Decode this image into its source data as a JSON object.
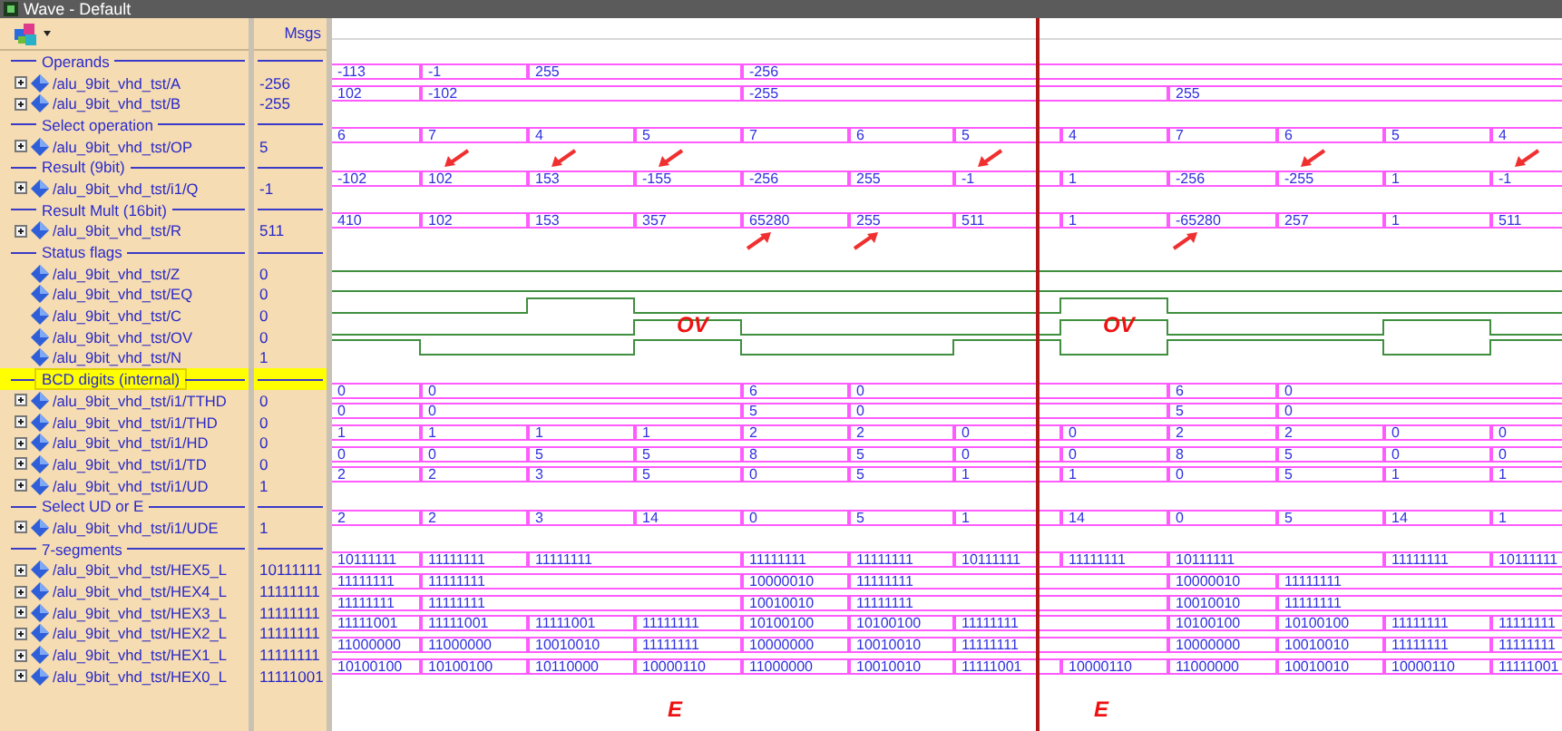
{
  "window": {
    "title": "Wave - Default"
  },
  "header": {
    "value_column": "Msgs"
  },
  "cursor_shown": true,
  "rows": [
    {
      "kind": "group",
      "label": "Operands",
      "highlighted": false
    },
    {
      "kind": "bus",
      "name": "/alu_9bit_vhd_tst/A",
      "value": "-256",
      "wave": [
        {
          "kind": "change",
          "value": "-113"
        },
        {
          "kind": "change",
          "value": "-1"
        },
        {
          "kind": "change",
          "value": "255"
        },
        {
          "kind": "hold"
        },
        {
          "kind": "change",
          "value": "-256"
        },
        {
          "kind": "hold"
        },
        {
          "kind": "hold"
        },
        {
          "kind": "hold"
        },
        {
          "kind": "hold"
        },
        {
          "kind": "hold"
        },
        {
          "kind": "hold"
        },
        {
          "kind": "hold"
        }
      ]
    },
    {
      "kind": "bus",
      "name": "/alu_9bit_vhd_tst/B",
      "value": "-255",
      "wave": [
        {
          "kind": "change",
          "value": "102"
        },
        {
          "kind": "change",
          "value": "-102"
        },
        {
          "kind": "hold"
        },
        {
          "kind": "hold"
        },
        {
          "kind": "change",
          "value": "-255"
        },
        {
          "kind": "hold"
        },
        {
          "kind": "hold"
        },
        {
          "kind": "hold"
        },
        {
          "kind": "change",
          "value": "255"
        },
        {
          "kind": "hold"
        },
        {
          "kind": "hold"
        },
        {
          "kind": "hold"
        }
      ]
    },
    {
      "kind": "group",
      "label": "Select operation",
      "highlighted": false
    },
    {
      "kind": "bus",
      "name": "/alu_9bit_vhd_tst/OP",
      "value": "5",
      "wave": [
        {
          "kind": "change",
          "value": "6"
        },
        {
          "kind": "change",
          "value": "7"
        },
        {
          "kind": "change",
          "value": "4"
        },
        {
          "kind": "change",
          "value": "5"
        },
        {
          "kind": "change",
          "value": "7"
        },
        {
          "kind": "change",
          "value": "6"
        },
        {
          "kind": "change",
          "value": "5"
        },
        {
          "kind": "change",
          "value": "4"
        },
        {
          "kind": "change",
          "value": "7"
        },
        {
          "kind": "change",
          "value": "6"
        },
        {
          "kind": "change",
          "value": "5"
        },
        {
          "kind": "change",
          "value": "4"
        }
      ]
    },
    {
      "kind": "group",
      "label": "Result (9bit)",
      "highlighted": false
    },
    {
      "kind": "bus",
      "name": "/alu_9bit_vhd_tst/i1/Q",
      "value": "-1",
      "wave": [
        {
          "kind": "change",
          "value": "-102",
          "arrow_above": false
        },
        {
          "kind": "change",
          "value": "102",
          "arrow_above": true
        },
        {
          "kind": "change",
          "value": "153",
          "arrow_above": true
        },
        {
          "kind": "change",
          "value": "-155",
          "arrow_above": true
        },
        {
          "kind": "change",
          "value": "-256",
          "arrow_above": false
        },
        {
          "kind": "change",
          "value": "255",
          "arrow_above": false
        },
        {
          "kind": "change",
          "value": "-1",
          "arrow_above": true
        },
        {
          "kind": "change",
          "value": "1",
          "arrow_above": false
        },
        {
          "kind": "change",
          "value": "-256",
          "arrow_above": false
        },
        {
          "kind": "change",
          "value": "-255",
          "arrow_above": true
        },
        {
          "kind": "change",
          "value": "1",
          "arrow_above": false
        },
        {
          "kind": "change",
          "value": "-1",
          "arrow_above": true
        }
      ]
    },
    {
      "kind": "group",
      "label": "Result Mult (16bit)",
      "highlighted": false
    },
    {
      "kind": "bus",
      "name": "/alu_9bit_vhd_tst/R",
      "value": "511",
      "wave": [
        {
          "kind": "change",
          "value": "410",
          "arrow_below": false
        },
        {
          "kind": "change",
          "value": "102",
          "arrow_below": false
        },
        {
          "kind": "change",
          "value": "153",
          "arrow_below": false
        },
        {
          "kind": "change",
          "value": "357",
          "arrow_below": false
        },
        {
          "kind": "change",
          "value": "65280",
          "arrow_below": true
        },
        {
          "kind": "change",
          "value": "255",
          "arrow_below": true
        },
        {
          "kind": "change",
          "value": "511",
          "arrow_below": false
        },
        {
          "kind": "change",
          "value": "1",
          "arrow_below": false
        },
        {
          "kind": "change",
          "value": "-65280",
          "arrow_below": true
        },
        {
          "kind": "change",
          "value": "257",
          "arrow_below": false
        },
        {
          "kind": "change",
          "value": "1",
          "arrow_below": false
        },
        {
          "kind": "change",
          "value": "511",
          "arrow_below": false
        }
      ]
    },
    {
      "kind": "group",
      "label": "Status flags",
      "highlighted": false
    },
    {
      "kind": "bit",
      "name": "/alu_9bit_vhd_tst/Z",
      "value": "0",
      "wave": [
        {
          "high": false
        },
        {
          "high": false
        },
        {
          "high": false
        },
        {
          "high": false
        },
        {
          "high": false
        },
        {
          "high": false
        },
        {
          "high": false
        },
        {
          "high": false
        },
        {
          "high": false
        },
        {
          "high": false
        },
        {
          "high": false
        },
        {
          "high": false
        }
      ]
    },
    {
      "kind": "bit",
      "name": "/alu_9bit_vhd_tst/EQ",
      "value": "0",
      "wave": [
        {
          "high": false
        },
        {
          "high": false
        },
        {
          "high": false
        },
        {
          "high": false
        },
        {
          "high": false
        },
        {
          "high": false
        },
        {
          "high": false
        },
        {
          "high": false
        },
        {
          "high": false
        },
        {
          "high": false
        },
        {
          "high": false
        },
        {
          "high": false
        }
      ]
    },
    {
      "kind": "bit",
      "name": "/alu_9bit_vhd_tst/C",
      "value": "0",
      "wave": [
        {
          "high": false
        },
        {
          "high": false
        },
        {
          "high": true
        },
        {
          "high": false
        },
        {
          "high": false
        },
        {
          "high": false
        },
        {
          "high": false
        },
        {
          "high": true
        },
        {
          "high": false
        },
        {
          "high": false
        },
        {
          "high": false
        },
        {
          "high": false
        }
      ]
    },
    {
      "kind": "bit",
      "name": "/alu_9bit_vhd_tst/OV",
      "value": "0",
      "wave": [
        {
          "high": false
        },
        {
          "high": false
        },
        {
          "high": false
        },
        {
          "high": true,
          "note": "OV"
        },
        {
          "high": false
        },
        {
          "high": false
        },
        {
          "high": false
        },
        {
          "high": true,
          "note": "OV"
        },
        {
          "high": false
        },
        {
          "high": false
        },
        {
          "high": true
        },
        {
          "high": false
        }
      ]
    },
    {
      "kind": "bit",
      "name": "/alu_9bit_vhd_tst/N",
      "value": "1",
      "wave": [
        {
          "high": true
        },
        {
          "high": false
        },
        {
          "high": false
        },
        {
          "high": true
        },
        {
          "high": false
        },
        {
          "high": false
        },
        {
          "high": true
        },
        {
          "high": false
        },
        {
          "high": true
        },
        {
          "high": true
        },
        {
          "high": false
        },
        {
          "high": true
        }
      ]
    },
    {
      "kind": "group",
      "label": "BCD digits (internal)",
      "highlighted": true
    },
    {
      "kind": "bus",
      "name": "/alu_9bit_vhd_tst/i1/TTHD",
      "value": "0",
      "wave": [
        {
          "kind": "change",
          "value": "0"
        },
        {
          "kind": "change",
          "value": "0"
        },
        {
          "kind": "hold"
        },
        {
          "kind": "hold"
        },
        {
          "kind": "change",
          "value": "6"
        },
        {
          "kind": "change",
          "value": "0"
        },
        {
          "kind": "hold"
        },
        {
          "kind": "hold"
        },
        {
          "kind": "change",
          "value": "6"
        },
        {
          "kind": "change",
          "value": "0"
        },
        {
          "kind": "hold"
        },
        {
          "kind": "hold"
        }
      ]
    },
    {
      "kind": "bus",
      "name": "/alu_9bit_vhd_tst/i1/THD",
      "value": "0",
      "wave": [
        {
          "kind": "change",
          "value": "0"
        },
        {
          "kind": "change",
          "value": "0"
        },
        {
          "kind": "hold"
        },
        {
          "kind": "hold"
        },
        {
          "kind": "change",
          "value": "5"
        },
        {
          "kind": "change",
          "value": "0"
        },
        {
          "kind": "hold"
        },
        {
          "kind": "hold"
        },
        {
          "kind": "change",
          "value": "5"
        },
        {
          "kind": "change",
          "value": "0"
        },
        {
          "kind": "hold"
        },
        {
          "kind": "hold"
        }
      ]
    },
    {
      "kind": "bus",
      "name": "/alu_9bit_vhd_tst/i1/HD",
      "value": "0",
      "wave": [
        {
          "kind": "change",
          "value": "1"
        },
        {
          "kind": "change",
          "value": "1"
        },
        {
          "kind": "change",
          "value": "1"
        },
        {
          "kind": "change",
          "value": "1"
        },
        {
          "kind": "change",
          "value": "2"
        },
        {
          "kind": "change",
          "value": "2"
        },
        {
          "kind": "change",
          "value": "0"
        },
        {
          "kind": "change",
          "value": "0"
        },
        {
          "kind": "change",
          "value": "2"
        },
        {
          "kind": "change",
          "value": "2"
        },
        {
          "kind": "change",
          "value": "0"
        },
        {
          "kind": "change",
          "value": "0"
        }
      ]
    },
    {
      "kind": "bus",
      "name": "/alu_9bit_vhd_tst/i1/TD",
      "value": "0",
      "wave": [
        {
          "kind": "change",
          "value": "0"
        },
        {
          "kind": "change",
          "value": "0"
        },
        {
          "kind": "change",
          "value": "5"
        },
        {
          "kind": "change",
          "value": "5"
        },
        {
          "kind": "change",
          "value": "8"
        },
        {
          "kind": "change",
          "value": "5"
        },
        {
          "kind": "change",
          "value": "0"
        },
        {
          "kind": "change",
          "value": "0"
        },
        {
          "kind": "change",
          "value": "8"
        },
        {
          "kind": "change",
          "value": "5"
        },
        {
          "kind": "change",
          "value": "0"
        },
        {
          "kind": "change",
          "value": "0"
        }
      ]
    },
    {
      "kind": "bus",
      "name": "/alu_9bit_vhd_tst/i1/UD",
      "value": "1",
      "wave": [
        {
          "kind": "change",
          "value": "2"
        },
        {
          "kind": "change",
          "value": "2"
        },
        {
          "kind": "change",
          "value": "3"
        },
        {
          "kind": "change",
          "value": "5"
        },
        {
          "kind": "change",
          "value": "0"
        },
        {
          "kind": "change",
          "value": "5"
        },
        {
          "kind": "change",
          "value": "1"
        },
        {
          "kind": "change",
          "value": "1"
        },
        {
          "kind": "change",
          "value": "0"
        },
        {
          "kind": "change",
          "value": "5"
        },
        {
          "kind": "change",
          "value": "1"
        },
        {
          "kind": "change",
          "value": "1"
        }
      ]
    },
    {
      "kind": "group",
      "label": "Select UD or E",
      "highlighted": false
    },
    {
      "kind": "bus",
      "name": "/alu_9bit_vhd_tst/i1/UDE",
      "value": "1",
      "wave": [
        {
          "kind": "change",
          "value": "2"
        },
        {
          "kind": "change",
          "value": "2"
        },
        {
          "kind": "change",
          "value": "3"
        },
        {
          "kind": "change",
          "value": "14"
        },
        {
          "kind": "change",
          "value": "0"
        },
        {
          "kind": "change",
          "value": "5"
        },
        {
          "kind": "change",
          "value": "1"
        },
        {
          "kind": "change",
          "value": "14"
        },
        {
          "kind": "change",
          "value": "0"
        },
        {
          "kind": "change",
          "value": "5"
        },
        {
          "kind": "change",
          "value": "14"
        },
        {
          "kind": "change",
          "value": "1"
        }
      ]
    },
    {
      "kind": "group",
      "label": "7-segments",
      "highlighted": false
    },
    {
      "kind": "bus",
      "name": "/alu_9bit_vhd_tst/HEX5_L",
      "value": "10111111",
      "wave": [
        {
          "kind": "change",
          "value": "10111111"
        },
        {
          "kind": "change",
          "value": "11111111"
        },
        {
          "kind": "change",
          "value": "11111111"
        },
        {
          "kind": "hold"
        },
        {
          "kind": "change",
          "value": "11111111"
        },
        {
          "kind": "change",
          "value": "11111111"
        },
        {
          "kind": "change",
          "value": "10111111"
        },
        {
          "kind": "change",
          "value": "11111111"
        },
        {
          "kind": "change",
          "value": "10111111"
        },
        {
          "kind": "hold"
        },
        {
          "kind": "change",
          "value": "11111111"
        },
        {
          "kind": "change",
          "value": "10111111"
        }
      ]
    },
    {
      "kind": "bus",
      "name": "/alu_9bit_vhd_tst/HEX4_L",
      "value": "11111111",
      "wave": [
        {
          "kind": "change",
          "value": "11111111"
        },
        {
          "kind": "change",
          "value": "11111111"
        },
        {
          "kind": "hold"
        },
        {
          "kind": "hold"
        },
        {
          "kind": "change",
          "value": "10000010"
        },
        {
          "kind": "change",
          "value": "11111111"
        },
        {
          "kind": "hold"
        },
        {
          "kind": "hold"
        },
        {
          "kind": "change",
          "value": "10000010"
        },
        {
          "kind": "change",
          "value": "11111111"
        },
        {
          "kind": "hold"
        },
        {
          "kind": "hold"
        }
      ]
    },
    {
      "kind": "bus",
      "name": "/alu_9bit_vhd_tst/HEX3_L",
      "value": "11111111",
      "wave": [
        {
          "kind": "change",
          "value": "11111111"
        },
        {
          "kind": "change",
          "value": "11111111"
        },
        {
          "kind": "hold"
        },
        {
          "kind": "hold"
        },
        {
          "kind": "change",
          "value": "10010010"
        },
        {
          "kind": "change",
          "value": "11111111"
        },
        {
          "kind": "hold"
        },
        {
          "kind": "hold"
        },
        {
          "kind": "change",
          "value": "10010010"
        },
        {
          "kind": "change",
          "value": "11111111"
        },
        {
          "kind": "hold"
        },
        {
          "kind": "hold"
        }
      ]
    },
    {
      "kind": "bus",
      "name": "/alu_9bit_vhd_tst/HEX2_L",
      "value": "11111111",
      "wave": [
        {
          "kind": "change",
          "value": "11111001"
        },
        {
          "kind": "change",
          "value": "11111001"
        },
        {
          "kind": "change",
          "value": "11111001"
        },
        {
          "kind": "change",
          "value": "11111111"
        },
        {
          "kind": "change",
          "value": "10100100"
        },
        {
          "kind": "change",
          "value": "10100100"
        },
        {
          "kind": "change",
          "value": "11111111"
        },
        {
          "kind": "hold"
        },
        {
          "kind": "change",
          "value": "10100100"
        },
        {
          "kind": "change",
          "value": "10100100"
        },
        {
          "kind": "change",
          "value": "11111111"
        },
        {
          "kind": "change",
          "value": "11111111"
        }
      ]
    },
    {
      "kind": "bus",
      "name": "/alu_9bit_vhd_tst/HEX1_L",
      "value": "11111111",
      "wave": [
        {
          "kind": "change",
          "value": "11000000"
        },
        {
          "kind": "change",
          "value": "11000000"
        },
        {
          "kind": "change",
          "value": "10010010"
        },
        {
          "kind": "change",
          "value": "11111111"
        },
        {
          "kind": "change",
          "value": "10000000"
        },
        {
          "kind": "change",
          "value": "10010010"
        },
        {
          "kind": "change",
          "value": "11111111"
        },
        {
          "kind": "hold"
        },
        {
          "kind": "change",
          "value": "10000000"
        },
        {
          "kind": "change",
          "value": "10010010"
        },
        {
          "kind": "change",
          "value": "11111111"
        },
        {
          "kind": "change",
          "value": "11111111"
        }
      ]
    },
    {
      "kind": "bus",
      "name": "/alu_9bit_vhd_tst/HEX0_L",
      "value": "11111001",
      "wave": [
        {
          "kind": "change",
          "value": "10100100"
        },
        {
          "kind": "change",
          "value": "10100100"
        },
        {
          "kind": "change",
          "value": "10110000"
        },
        {
          "kind": "change",
          "value": "10000110"
        },
        {
          "kind": "change",
          "value": "11000000"
        },
        {
          "kind": "change",
          "value": "10010010"
        },
        {
          "kind": "change",
          "value": "11111001"
        },
        {
          "kind": "change",
          "value": "10000110"
        },
        {
          "kind": "change",
          "value": "11000000"
        },
        {
          "kind": "change",
          "value": "10010010"
        },
        {
          "kind": "change",
          "value": "10000110"
        },
        {
          "kind": "change",
          "value": "11111001"
        }
      ]
    }
  ],
  "footnotes": [
    {
      "kind": "empty"
    },
    {
      "kind": "empty"
    },
    {
      "kind": "empty"
    },
    {
      "kind": "note",
      "text": "E"
    },
    {
      "kind": "empty"
    },
    {
      "kind": "empty"
    },
    {
      "kind": "empty"
    },
    {
      "kind": "note",
      "text": "E"
    },
    {
      "kind": "empty"
    },
    {
      "kind": "empty"
    },
    {
      "kind": "empty"
    },
    {
      "kind": "empty"
    }
  ]
}
